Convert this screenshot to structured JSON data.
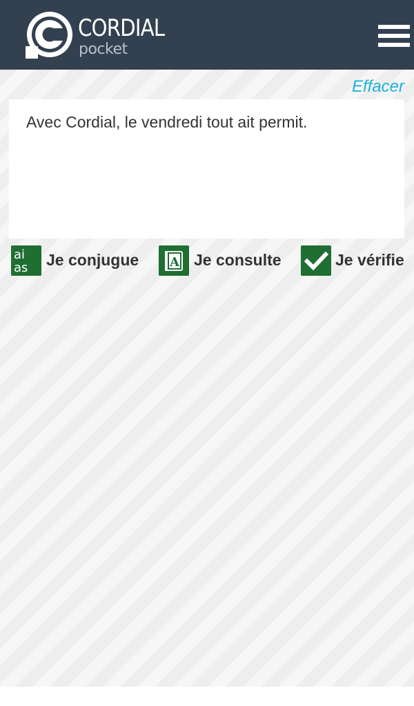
{
  "header": {
    "logo_word": "CORDIAL",
    "logo_sub": "pocket"
  },
  "editor": {
    "clear_label": "Effacer",
    "text": "Avec Cordial, le vendredi tout ait permit."
  },
  "actions": {
    "conjugate": {
      "label": "Je conjugue",
      "icon_text_top": "ai",
      "icon_text_bottom": "as"
    },
    "consult": {
      "label": "Je consulte",
      "icon_letter": "A"
    },
    "verify": {
      "label": "Je vérifie"
    }
  },
  "colors": {
    "header_bg": "#334050",
    "accent_link": "#1ab3d9",
    "icon_green": "#1f6e32",
    "text": "#333333"
  }
}
